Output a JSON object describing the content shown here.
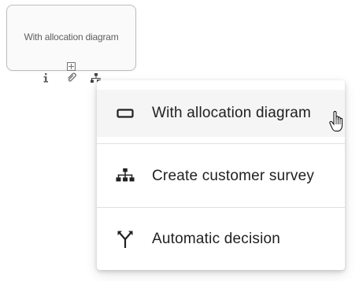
{
  "shape": {
    "label": "With allocation diagram",
    "subprocess_icon": "plus-square-icon"
  },
  "shape_toolbar": {
    "icons": [
      "info-icon",
      "attachment-icon",
      "object-type-icon"
    ]
  },
  "menu": {
    "hovered_index": 0,
    "items": [
      {
        "label": "With allocation diagram",
        "icon": "rectangle-outline-icon"
      },
      {
        "label": "Create customer survey",
        "icon": "org-hierarchy-icon"
      },
      {
        "label": "Automatic decision",
        "icon": "merge-split-arrows-icon"
      }
    ]
  },
  "colors": {
    "shape_border": "#bdbdbd",
    "shape_fill": "#fafafa",
    "menu_hover": "#f5f5f5",
    "text_primary": "#212121",
    "text_secondary": "#616161"
  }
}
